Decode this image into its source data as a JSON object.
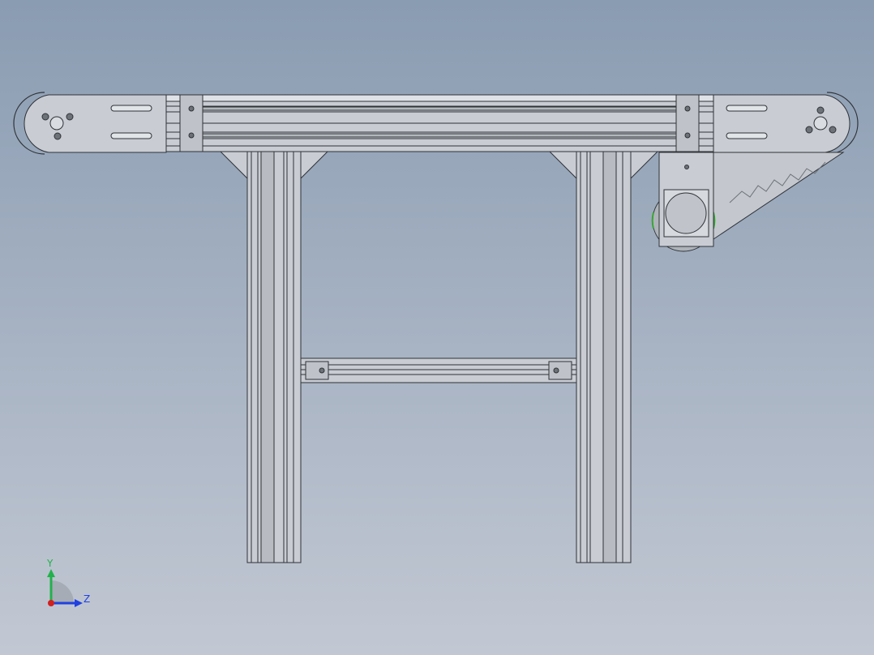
{
  "viewport": {
    "background_top": "#8a9cb2",
    "background_bottom": "#c2c8d3"
  },
  "colors": {
    "metal_fill": "#c9cdd3",
    "metal_dark": "#9ea3aa",
    "edge": "#2f3338",
    "belt": "#dfe2e6",
    "accent_green": "#3aa636"
  },
  "triad": {
    "y_label": "Y",
    "z_label": "Z",
    "y_color": "#22b14c",
    "z_color": "#2040e0",
    "x_color": "#d02020"
  }
}
